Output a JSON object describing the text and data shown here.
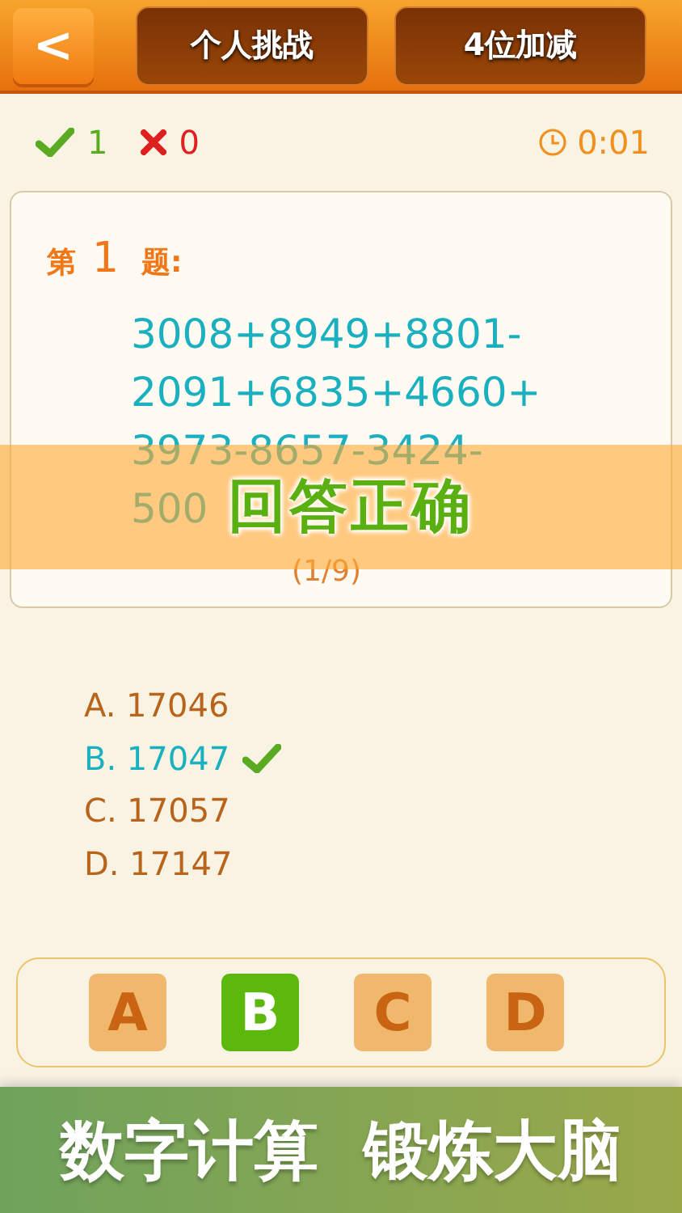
{
  "header": {
    "back": "<",
    "tabs": [
      {
        "label": "个人挑战"
      },
      {
        "label": "4位加减"
      }
    ]
  },
  "stats": {
    "correct": "1",
    "wrong": "0",
    "time": "0:01"
  },
  "question": {
    "prefix": "第",
    "number": "1",
    "suffix": "题:",
    "lines": [
      "3008+8949+8801-",
      "2091+6835+4660+",
      "3973-8657-3424-",
      "500"
    ],
    "progress": "(1/9)"
  },
  "result_banner": "回答正确",
  "options": [
    {
      "label": "A. 17046",
      "correct": false
    },
    {
      "label": "B. 17047",
      "correct": true
    },
    {
      "label": "C. 17057",
      "correct": false
    },
    {
      "label": "D. 17147",
      "correct": false
    }
  ],
  "answer_buttons": [
    {
      "label": "A",
      "selected": false
    },
    {
      "label": "B",
      "selected": true
    },
    {
      "label": "C",
      "selected": false
    },
    {
      "label": "D",
      "selected": false
    }
  ],
  "promo": "数字计算  锻炼大脑"
}
